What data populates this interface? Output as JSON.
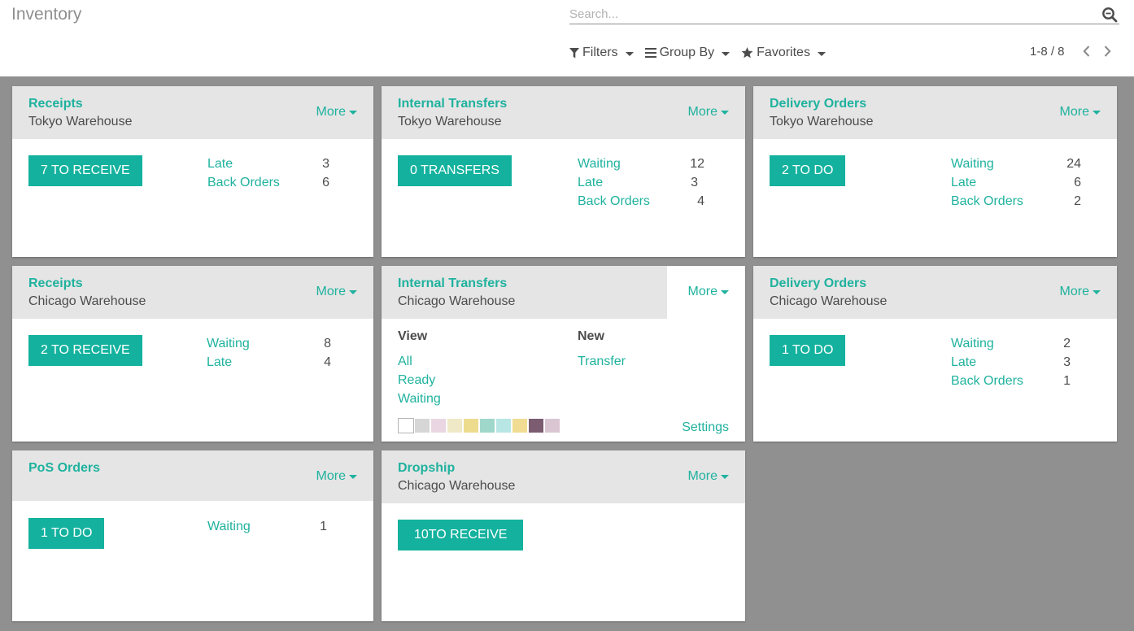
{
  "app": {
    "title": "Inventory"
  },
  "search": {
    "placeholder": "Search..."
  },
  "search_options": {
    "filters": "Filters",
    "group_by": "Group By",
    "favorites": "Favorites"
  },
  "pager": {
    "value": "1-8 / 8"
  },
  "accent_color": "#1fb29e",
  "cards": [
    {
      "title": "Receipts",
      "subtitle": "Tokyo Warehouse",
      "more": "More",
      "button": "7 To Receive",
      "stats": [
        {
          "label": "Late",
          "count": "3"
        },
        {
          "label": "Back Orders",
          "count": "6"
        }
      ]
    },
    {
      "title": "Internal Transfers",
      "subtitle": "Tokyo Warehouse",
      "more": "More",
      "button": "0 Transfers",
      "stats": [
        {
          "label": "Waiting",
          "count": "12"
        },
        {
          "label": "Late",
          "count": "3"
        },
        {
          "label": "Back Orders",
          "count": "4"
        }
      ]
    },
    {
      "title": "Delivery Orders",
      "subtitle": "Tokyo Warehouse",
      "more": "More",
      "button": "2 To Do",
      "stats": [
        {
          "label": "Waiting",
          "count": "24"
        },
        {
          "label": "Late",
          "count": "6"
        },
        {
          "label": "Back Orders",
          "count": "2"
        }
      ]
    },
    {
      "title": "Receipts",
      "subtitle": "Chicago Warehouse",
      "more": "More",
      "button": "2 To Receive",
      "stats": [
        {
          "label": "Waiting",
          "count": "8"
        },
        {
          "label": "Late",
          "count": "4"
        }
      ]
    },
    {
      "title": "Internal Transfers",
      "subtitle": "Chicago Warehouse",
      "more": "More",
      "dropdown": {
        "view_title": "View",
        "view_links": [
          "All",
          "Ready",
          "Waiting"
        ],
        "new_title": "New",
        "new_links": [
          "Transfer"
        ],
        "settings": "Settings",
        "colors": [
          "#ffffff",
          "#d6d6d6",
          "#ead6e2",
          "#efe9c8",
          "#eedc8e",
          "#9fd8cb",
          "#b7e6e4",
          "#f0dd93",
          "#7b5c70",
          "#dac6d3"
        ]
      }
    },
    {
      "title": "Delivery Orders",
      "subtitle": "Chicago Warehouse",
      "more": "More",
      "button": "1 To Do",
      "stats": [
        {
          "label": "Waiting",
          "count": "2"
        },
        {
          "label": "Late",
          "count": "3"
        },
        {
          "label": "Back Orders",
          "count": "1"
        }
      ]
    },
    {
      "title": "PoS Orders",
      "subtitle": "",
      "more": "More",
      "button": "1 To Do",
      "stats": [
        {
          "label": "Waiting",
          "count": "1"
        }
      ]
    },
    {
      "title": "Dropship",
      "subtitle": "Chicago Warehouse",
      "more": "More",
      "button": "10To Receive",
      "stats": []
    }
  ]
}
